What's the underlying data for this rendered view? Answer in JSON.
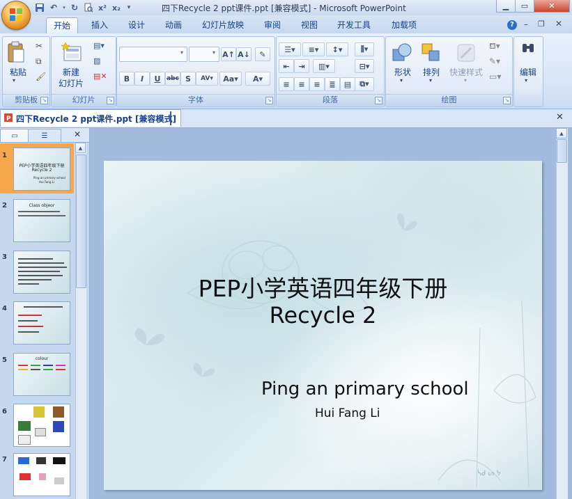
{
  "window": {
    "title": "四下Recycle 2 ppt课件.ppt [兼容模式] - Microsoft PowerPoint"
  },
  "ribbon": {
    "tabs": [
      {
        "label": "开始"
      },
      {
        "label": "插入"
      },
      {
        "label": "设计"
      },
      {
        "label": "动画"
      },
      {
        "label": "幻灯片放映"
      },
      {
        "label": "审阅"
      },
      {
        "label": "视图"
      },
      {
        "label": "开发工具"
      },
      {
        "label": "加载项"
      }
    ],
    "groups": {
      "clipboard": {
        "label": "剪贴板",
        "paste": "粘贴"
      },
      "slides": {
        "label": "幻灯片",
        "new_slide_line1": "新建",
        "new_slide_line2": "幻灯片"
      },
      "font": {
        "label": "字体",
        "font_name": "",
        "font_size": ""
      },
      "paragraph": {
        "label": "段落"
      },
      "drawing": {
        "label": "绘图",
        "shapes": "形状",
        "arrange": "排列",
        "quick_styles": "快速样式"
      },
      "editing": {
        "label": "编辑"
      }
    }
  },
  "document_tab": {
    "label": "四下Recycle 2 ppt课件.ppt [兼容模式]"
  },
  "slides_panel": {
    "thumbnails": [
      {
        "number": "1",
        "line1": "PEP小学英语四年级下册",
        "line2": "Recycle 2",
        "line3": "Ping an primary school",
        "line4": "Hui Fang Li"
      },
      {
        "number": "2",
        "line1": "Class objeor"
      },
      {
        "number": "3"
      },
      {
        "number": "4"
      },
      {
        "number": "5",
        "line1": "colour"
      },
      {
        "number": "6"
      },
      {
        "number": "7"
      }
    ]
  },
  "slide": {
    "title_line1": "PEP小学英语四年级下册",
    "title_line2": "Recycle 2",
    "school": "Ping  an  primary school",
    "author": "Hui  Fang  Li"
  },
  "colors": {
    "accent": "#15428b",
    "ribbon_bg": "#dbe7f6",
    "selected_thumb": "#f6a64b"
  }
}
